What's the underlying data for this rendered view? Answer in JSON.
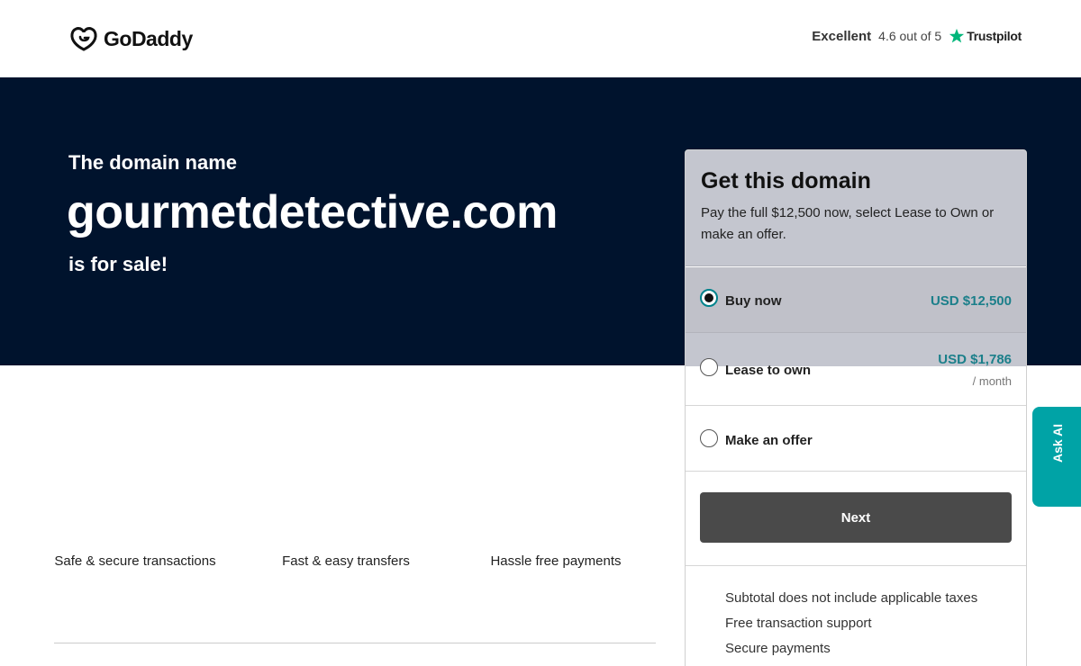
{
  "header": {
    "brand": "GoDaddy",
    "trustpilot": {
      "label": "Excellent",
      "rating": "4.6 out of 5",
      "brand": "Trustpilot",
      "star_color": "#00b67a"
    }
  },
  "hero": {
    "kicker": "The domain name",
    "domain": "gourmetdetective.com",
    "suffix": "is for sale!"
  },
  "features": [
    {
      "text": "Safe & secure transactions"
    },
    {
      "text": "Fast & easy transfers"
    },
    {
      "text": "Hassle free payments"
    }
  ],
  "card": {
    "title": "Get this domain",
    "description": "Pay the full $12,500 now, select Lease to Own or make an offer.",
    "options": [
      {
        "label": "Buy now",
        "price": "USD $12,500",
        "selected": true
      },
      {
        "label": "Lease to own",
        "price": "USD $1,786",
        "sub": "/ month",
        "selected": false
      },
      {
        "label": "Make an offer",
        "selected": false
      }
    ],
    "next_label": "Next",
    "info": [
      "Subtotal does not include applicable taxes",
      "Free transaction support",
      "Secure payments"
    ]
  },
  "ask_ai": {
    "label": "Ask AI"
  },
  "colors": {
    "hero_bg": "#00132d",
    "accent": "#1b7f8a",
    "ask_ai_bg": "#00a3a6",
    "next_bg": "#4a4a4a"
  }
}
